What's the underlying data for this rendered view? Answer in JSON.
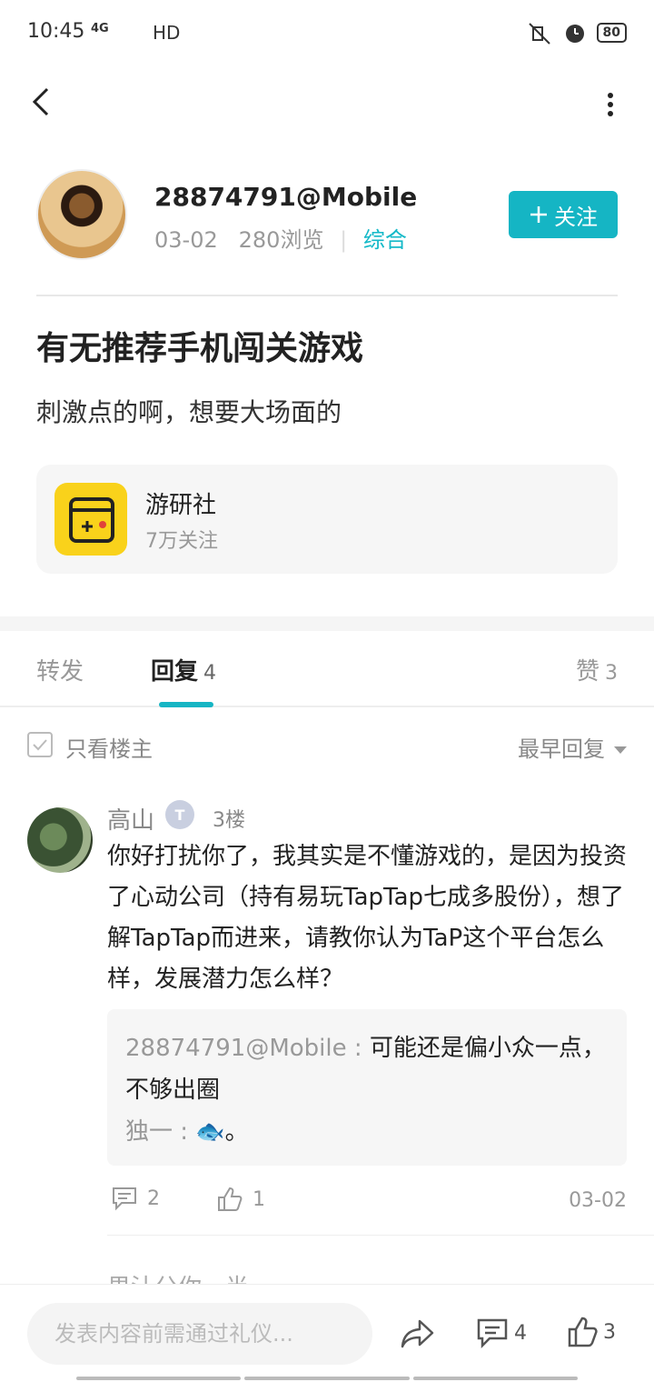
{
  "status_bar": {
    "time": "10:45",
    "network": "4G",
    "hd": "HD",
    "battery": "80"
  },
  "author": {
    "name": "28874791@Mobile",
    "date": "03-02",
    "views": "280浏览",
    "category": "综合",
    "follow_label": "关注"
  },
  "post": {
    "title": "有无推荐手机闯关游戏",
    "body": "刺激点的啊，想要大场面的"
  },
  "group": {
    "name": "游研社",
    "followers": "7万关注"
  },
  "tabs": {
    "forward": "转发",
    "reply": "回复",
    "reply_count": "4",
    "like": "赞",
    "like_count": "3"
  },
  "filter": {
    "only_op": "只看楼主",
    "sort": "最早回复"
  },
  "reply": {
    "user": "高山",
    "badge": "T",
    "floor": "3楼",
    "text": "你好打扰你了，我其实是不懂游戏的，是因为投资了心动公司（持有易玩TapTap七成多股份），想了解TapTap而进来，请教你认为TaP这个平台怎么样，发展潜力怎么样？",
    "sub_replies": [
      {
        "user": "28874791@Mobile",
        "sep": " : ",
        "text": "可能还是偏小众一点，不够出圈"
      },
      {
        "user": "独一",
        "sep": " : ",
        "text": "🐟。"
      }
    ],
    "comment_count": "2",
    "like_count": "1",
    "date": "03-02"
  },
  "next_reply_peek": "果汁分你一半",
  "bottom_bar": {
    "input_placeholder": "发表内容前需通过礼仪...",
    "comment_count": "4",
    "like_count": "3"
  },
  "colors": {
    "accent": "#15b5c4",
    "group_icon": "#f9d21b"
  }
}
